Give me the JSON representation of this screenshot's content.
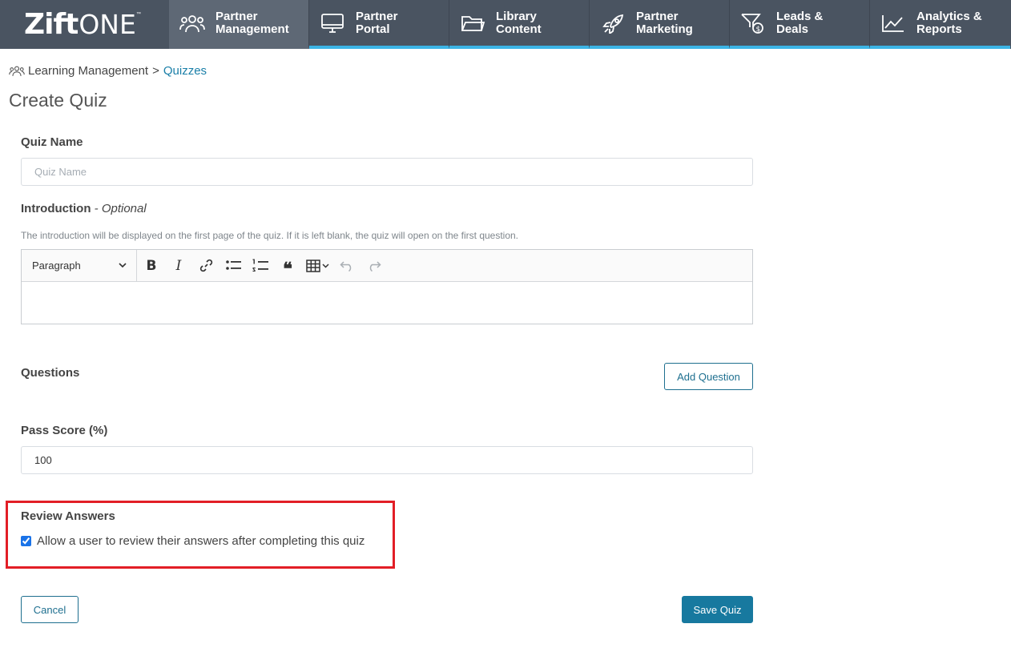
{
  "brand": {
    "name_bold": "Zift",
    "name_light": "ONE",
    "trademark": "™"
  },
  "nav": {
    "items": [
      {
        "label": "Partner\nManagement",
        "icon": "users-icon",
        "active": true
      },
      {
        "label": "Partner\nPortal",
        "icon": "monitor-icon",
        "active": false
      },
      {
        "label": "Library\nContent",
        "icon": "folder-icon",
        "active": false
      },
      {
        "label": "Partner\nMarketing",
        "icon": "rocket-icon",
        "active": false
      },
      {
        "label": "Leads &\nDeals",
        "icon": "funnel-dollar-icon",
        "active": false
      },
      {
        "label": "Analytics &\nReports",
        "icon": "line-chart-icon",
        "active": false
      }
    ]
  },
  "breadcrumb": {
    "parent": "Learning Management",
    "separator": ">",
    "current": "Quizzes"
  },
  "page": {
    "title": "Create Quiz"
  },
  "form": {
    "quiz_name": {
      "label": "Quiz Name",
      "placeholder": "Quiz Name",
      "value": ""
    },
    "introduction": {
      "label": "Introduction",
      "optional": "- Optional",
      "hint": "The introduction will be displayed on the first page of the quiz. If it is left blank, the quiz will open on the first question.",
      "format": "Paragraph"
    },
    "questions": {
      "label": "Questions",
      "add_button": "Add Question"
    },
    "pass_score": {
      "label": "Pass Score (%)",
      "value": "100"
    },
    "review_answers": {
      "label": "Review Answers",
      "checkbox_label": "Allow a user to review their answers after completing this quiz",
      "checked": true
    },
    "cancel_button": "Cancel",
    "save_button": "Save Quiz"
  },
  "colors": {
    "nav_bg": "#4a5461",
    "nav_active": "#5e6875",
    "nav_accent": "#3cb4e5",
    "link": "#1a7fa8",
    "primary": "#17799f",
    "highlight": "#e21e26"
  }
}
